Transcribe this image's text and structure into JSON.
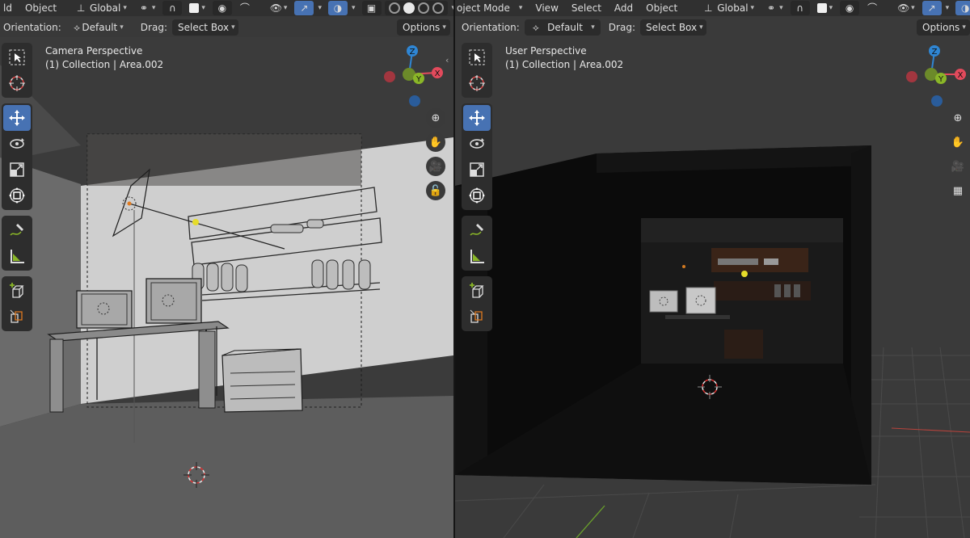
{
  "left": {
    "menu": [
      "ld",
      "Object"
    ],
    "transform_orientation": "Global",
    "header2": {
      "orientation_label": "Orientation:",
      "orientation_value": "Default",
      "drag_label": "Drag:",
      "drag_value": "Select Box",
      "options": "Options"
    },
    "overlay": {
      "view_name": "Camera Perspective",
      "collection": "(1) Collection | Area.002"
    }
  },
  "right": {
    "menu": [
      "oject Mode",
      "View",
      "Select",
      "Add",
      "Object"
    ],
    "transform_orientation": "Global",
    "header2": {
      "orientation_label": "Orientation:",
      "orientation_value": "Default",
      "drag_label": "Drag:",
      "drag_value": "Select Box",
      "options": "Options"
    },
    "overlay": {
      "view_name": "User Perspective",
      "collection": "(1) Collection | Area.002"
    }
  },
  "gizmo": {
    "z": "Z",
    "y": "Y",
    "x": "X"
  },
  "colors": {
    "accent": "#4772b3",
    "x_axis": "#e24a5c",
    "y_axis": "#8ab628",
    "z_axis": "#2f86d4",
    "light_dot": "#e6dc2a"
  },
  "icons": {
    "tools": [
      "select-box-icon",
      "cursor-icon",
      "move-icon",
      "rotate-icon",
      "scale-icon",
      "transform-icon",
      "annotate-icon",
      "measure-icon",
      "add-cube-icon",
      "extrude-icon"
    ],
    "nav_left": [
      "zoom-icon",
      "hand-pan-icon",
      "camera-view-icon",
      "lock-camera-icon"
    ],
    "nav_right": [
      "zoom-icon",
      "hand-pan-icon",
      "camera-view-icon",
      "ortho-grid-icon"
    ]
  }
}
